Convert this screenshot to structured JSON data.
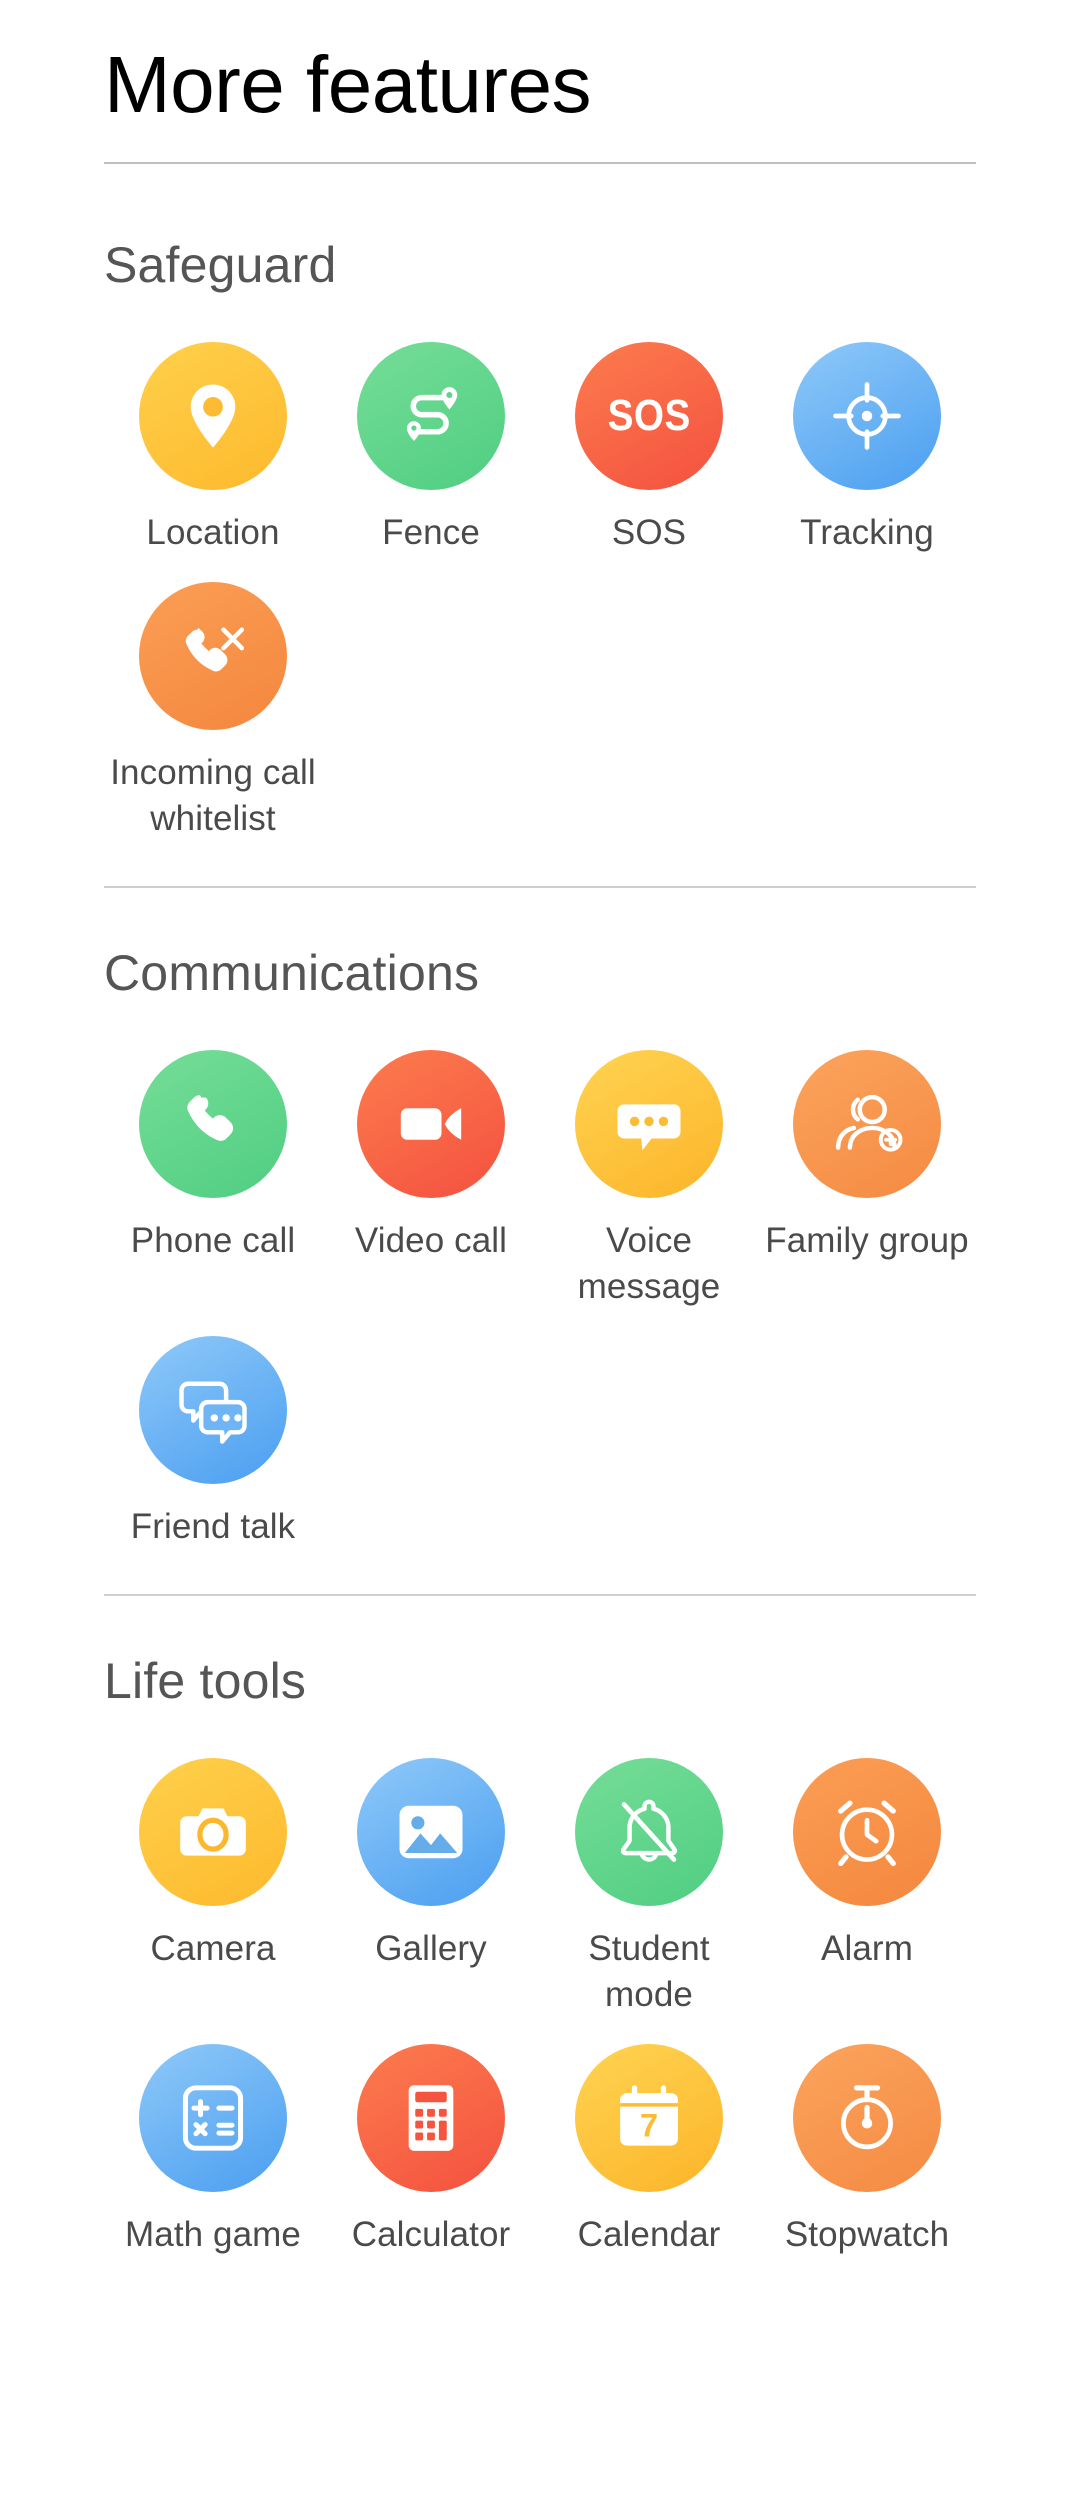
{
  "header": {
    "title": "More features"
  },
  "colors": {
    "yellow": "#fdb92d",
    "green": "#4fce82",
    "red": "#f4513f",
    "blue": "#4a9ef0",
    "orange": "#f4873e",
    "label_text": "#4a4a4a",
    "section_text": "#555555",
    "title_text": "#000000",
    "background": "#ffffff",
    "divider": "#cfcfcf"
  },
  "sections": [
    {
      "title": "Safeguard",
      "items": [
        {
          "label": "Location",
          "icon": "map-pin-icon",
          "theme": "g-yellow"
        },
        {
          "label": "Fence",
          "icon": "route-fence-icon",
          "theme": "g-green"
        },
        {
          "label": "SOS",
          "icon": "sos-icon",
          "theme": "g-red",
          "text": "SOS"
        },
        {
          "label": "Tracking",
          "icon": "crosshair-icon",
          "theme": "g-blue"
        },
        {
          "label": "Incoming call whitelist",
          "icon": "call-block-icon",
          "theme": "g-orange"
        }
      ]
    },
    {
      "title": "Communications",
      "items": [
        {
          "label": "Phone call",
          "icon": "phone-handset-icon",
          "theme": "g-green"
        },
        {
          "label": "Video call",
          "icon": "video-camera-icon",
          "theme": "g-red"
        },
        {
          "label": "Voice message",
          "icon": "speech-bubble-icon",
          "theme": "g-yellow2"
        },
        {
          "label": "Family group",
          "icon": "group-add-icon",
          "theme": "g-orange2"
        },
        {
          "label": "Friend talk",
          "icon": "chat-bubbles-icon",
          "theme": "g-blue"
        }
      ]
    },
    {
      "title": "Life tools",
      "items": [
        {
          "label": "Camera",
          "icon": "camera-icon",
          "theme": "g-yellow"
        },
        {
          "label": "Gallery",
          "icon": "image-icon",
          "theme": "g-blue"
        },
        {
          "label": "Student mode",
          "icon": "bell-muted-icon",
          "theme": "g-green"
        },
        {
          "label": "Alarm",
          "icon": "alarm-clock-icon",
          "theme": "g-orange"
        },
        {
          "label": "Math game",
          "icon": "math-symbols-icon",
          "theme": "g-blue"
        },
        {
          "label": "Calculator",
          "icon": "calculator-icon",
          "theme": "g-red"
        },
        {
          "label": "Calendar",
          "icon": "calendar-icon",
          "theme": "g-yellow2",
          "text": "7"
        },
        {
          "label": "Stopwatch",
          "icon": "stopwatch-icon",
          "theme": "g-orange2"
        }
      ]
    }
  ]
}
